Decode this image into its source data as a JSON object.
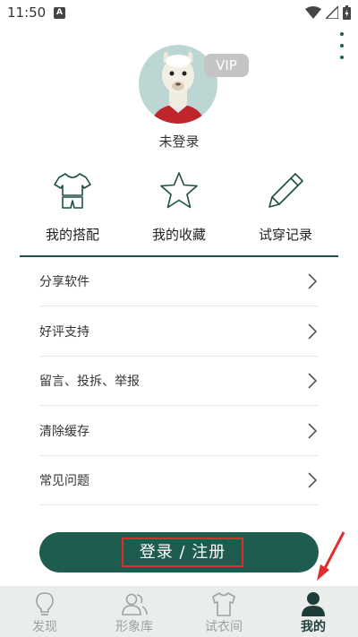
{
  "status_bar": {
    "time": "11:50",
    "notif_letter": "A"
  },
  "profile": {
    "vip_badge": "VIP",
    "login_status": "未登录"
  },
  "quick_actions": [
    {
      "label": "我的搭配",
      "icon": "shirt-icon"
    },
    {
      "label": "我的收藏",
      "icon": "star-icon"
    },
    {
      "label": "试穿记录",
      "icon": "pencil-icon"
    }
  ],
  "menu": [
    {
      "label": "分享软件"
    },
    {
      "label": "好评支持"
    },
    {
      "label": "留言、投拆、举报"
    },
    {
      "label": "清除缓存"
    },
    {
      "label": "常见问题"
    }
  ],
  "login_button": {
    "label": "登录 / 注册"
  },
  "bottom_nav": [
    {
      "label": "发现",
      "icon": "bulb-icon",
      "active": false
    },
    {
      "label": "形象库",
      "icon": "people-icon",
      "active": false
    },
    {
      "label": "试衣间",
      "icon": "tshirt-icon",
      "active": false
    },
    {
      "label": "我的",
      "icon": "person-icon",
      "active": true
    }
  ],
  "colors": {
    "accent": "#1f5c50",
    "highlight": "#e02c2c",
    "nav_bg": "#e9eeed"
  }
}
